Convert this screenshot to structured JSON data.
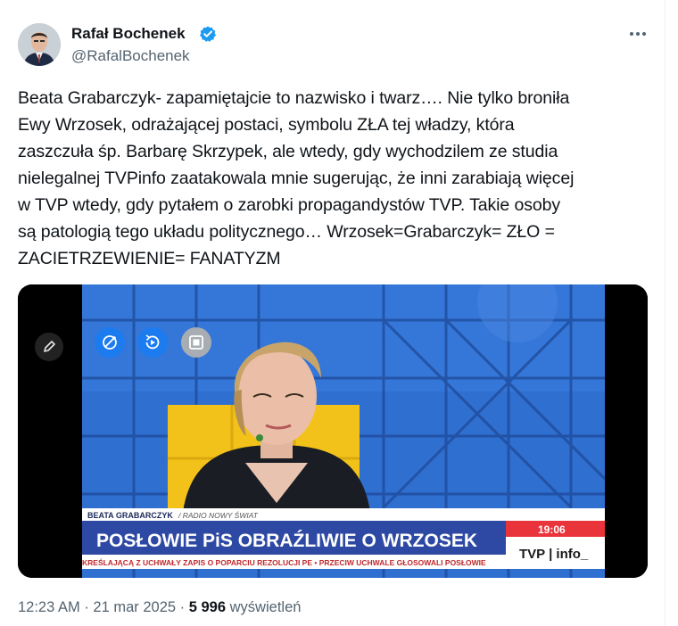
{
  "author": {
    "name": "Rafał Bochenek",
    "handle": "@RafalBochenek",
    "verified": true
  },
  "more_icon": "more-horizontal-icon",
  "tweet": {
    "text": "Beata Grabarczyk- zapamiętajcie to nazwisko i twarz…. Nie tylko broniła\nEwy Wrzosek, odrażającej postaci, symbolu ZŁA tej władzy, która\nzaszczuła śp. Barbarę Skrzypek, ale wtedy, gdy wychodzilem ze studia\nnielegalnej TVPinfo zaatakowala mnie sugerując, że inni zarabiają więcej\nw TVP wtedy, gdy pytałem o zarobki propagandystów TVP. Takie osoby\nsą patologią tego układu politycznego… Wrzosek=Grabarczyk= ZŁO =\nZACIETRZEWIENIE= FANATYZM"
  },
  "media": {
    "lower_third_name": "BEATA GRABARCZYK",
    "lower_third_source": "/ RADIO NOWY ŚWIAT",
    "headline": "POSŁOWIE PiS OBRAŹLIWIE O WRZOSEK",
    "ticker": "KREŚLAJĄCĄ Z UCHWAŁY ZAPIS O POPARCIU REZOLUCJI PE • PRZECIW UCHWALE GŁOSOWALI POSŁOWIE",
    "clock": "19:06",
    "channel_logo": "TVP | info_",
    "controls": [
      "edit-icon",
      "alt-text-icon",
      "replay-icon",
      "stop-icon"
    ],
    "colors": {
      "studio_blue": "#2f6fd0",
      "headline_bar": "#2d49a3",
      "ticker_bar": "#e8343a",
      "yellow_panel": "#f3c21a"
    }
  },
  "meta": {
    "time": "12:23 AM",
    "separator": "·",
    "date": "21 mar 2025",
    "views_count": "5 996",
    "views_label": "wyświetleń"
  },
  "colors": {
    "text": "#0f1419",
    "secondary": "#536471",
    "verified_blue": "#1d9bf0"
  }
}
